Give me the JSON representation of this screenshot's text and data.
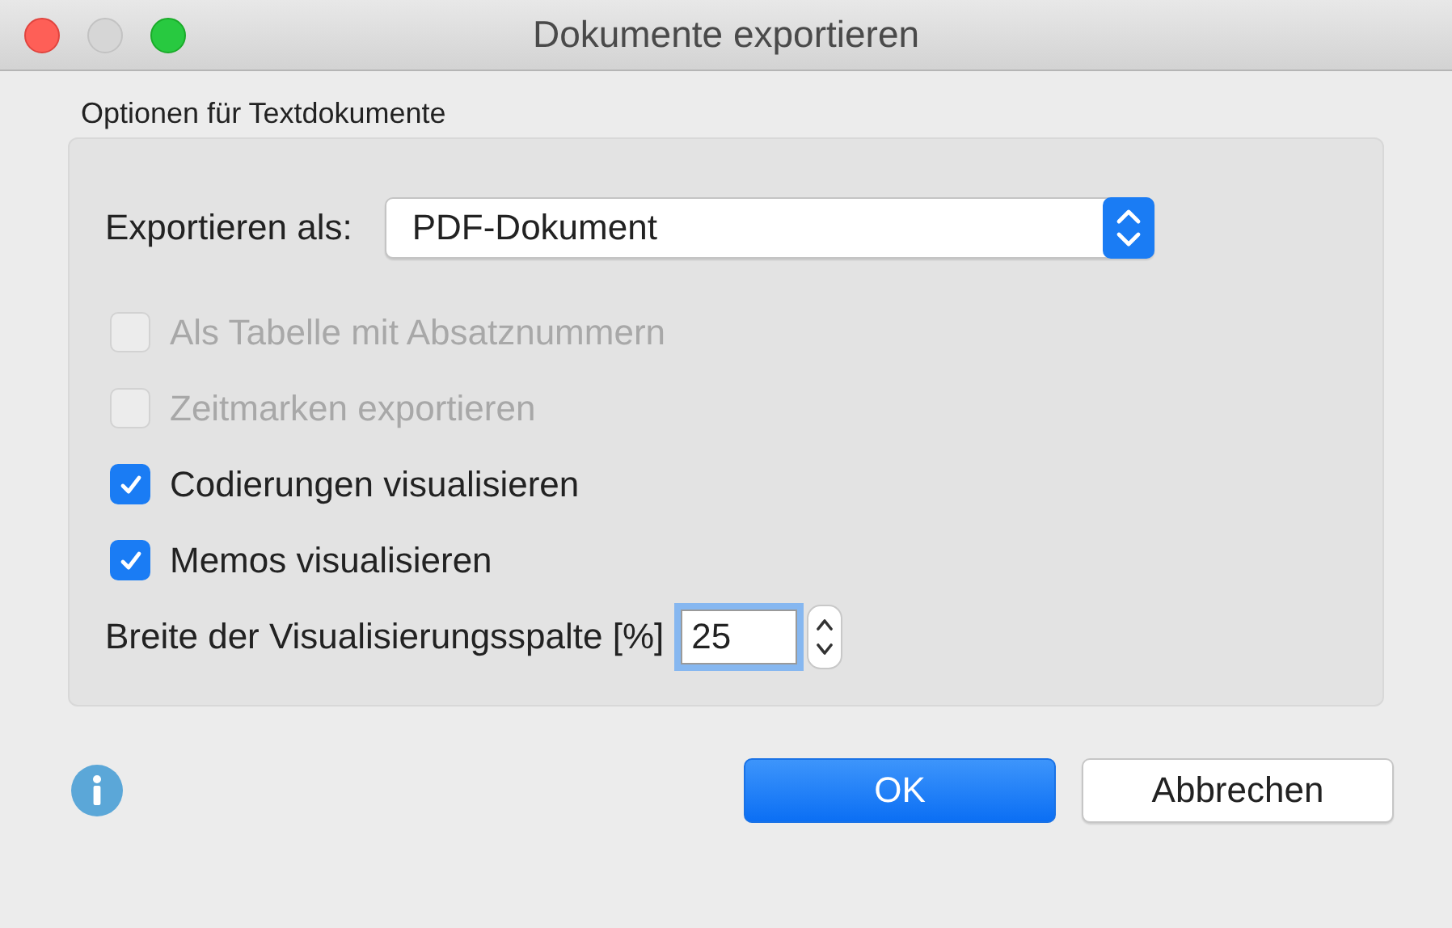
{
  "window": {
    "title": "Dokumente exportieren"
  },
  "section": {
    "title": "Optionen für Textdokumente"
  },
  "export_as": {
    "label": "Exportieren als:",
    "value": "PDF-Dokument"
  },
  "options": [
    {
      "label": "Als Tabelle mit Absatznummern",
      "checked": false,
      "disabled": true
    },
    {
      "label": "Zeitmarken exportieren",
      "checked": false,
      "disabled": true
    },
    {
      "label": "Codierungen visualisieren",
      "checked": true,
      "disabled": false
    },
    {
      "label": "Memos visualisieren",
      "checked": true,
      "disabled": false
    }
  ],
  "column_width": {
    "label": "Breite der Visualisierungsspalte [%]",
    "value": "25",
    "focused": true
  },
  "buttons": [
    {
      "label": "OK",
      "kind": "primary"
    },
    {
      "label": "Abbrechen",
      "kind": "secondary"
    }
  ]
}
